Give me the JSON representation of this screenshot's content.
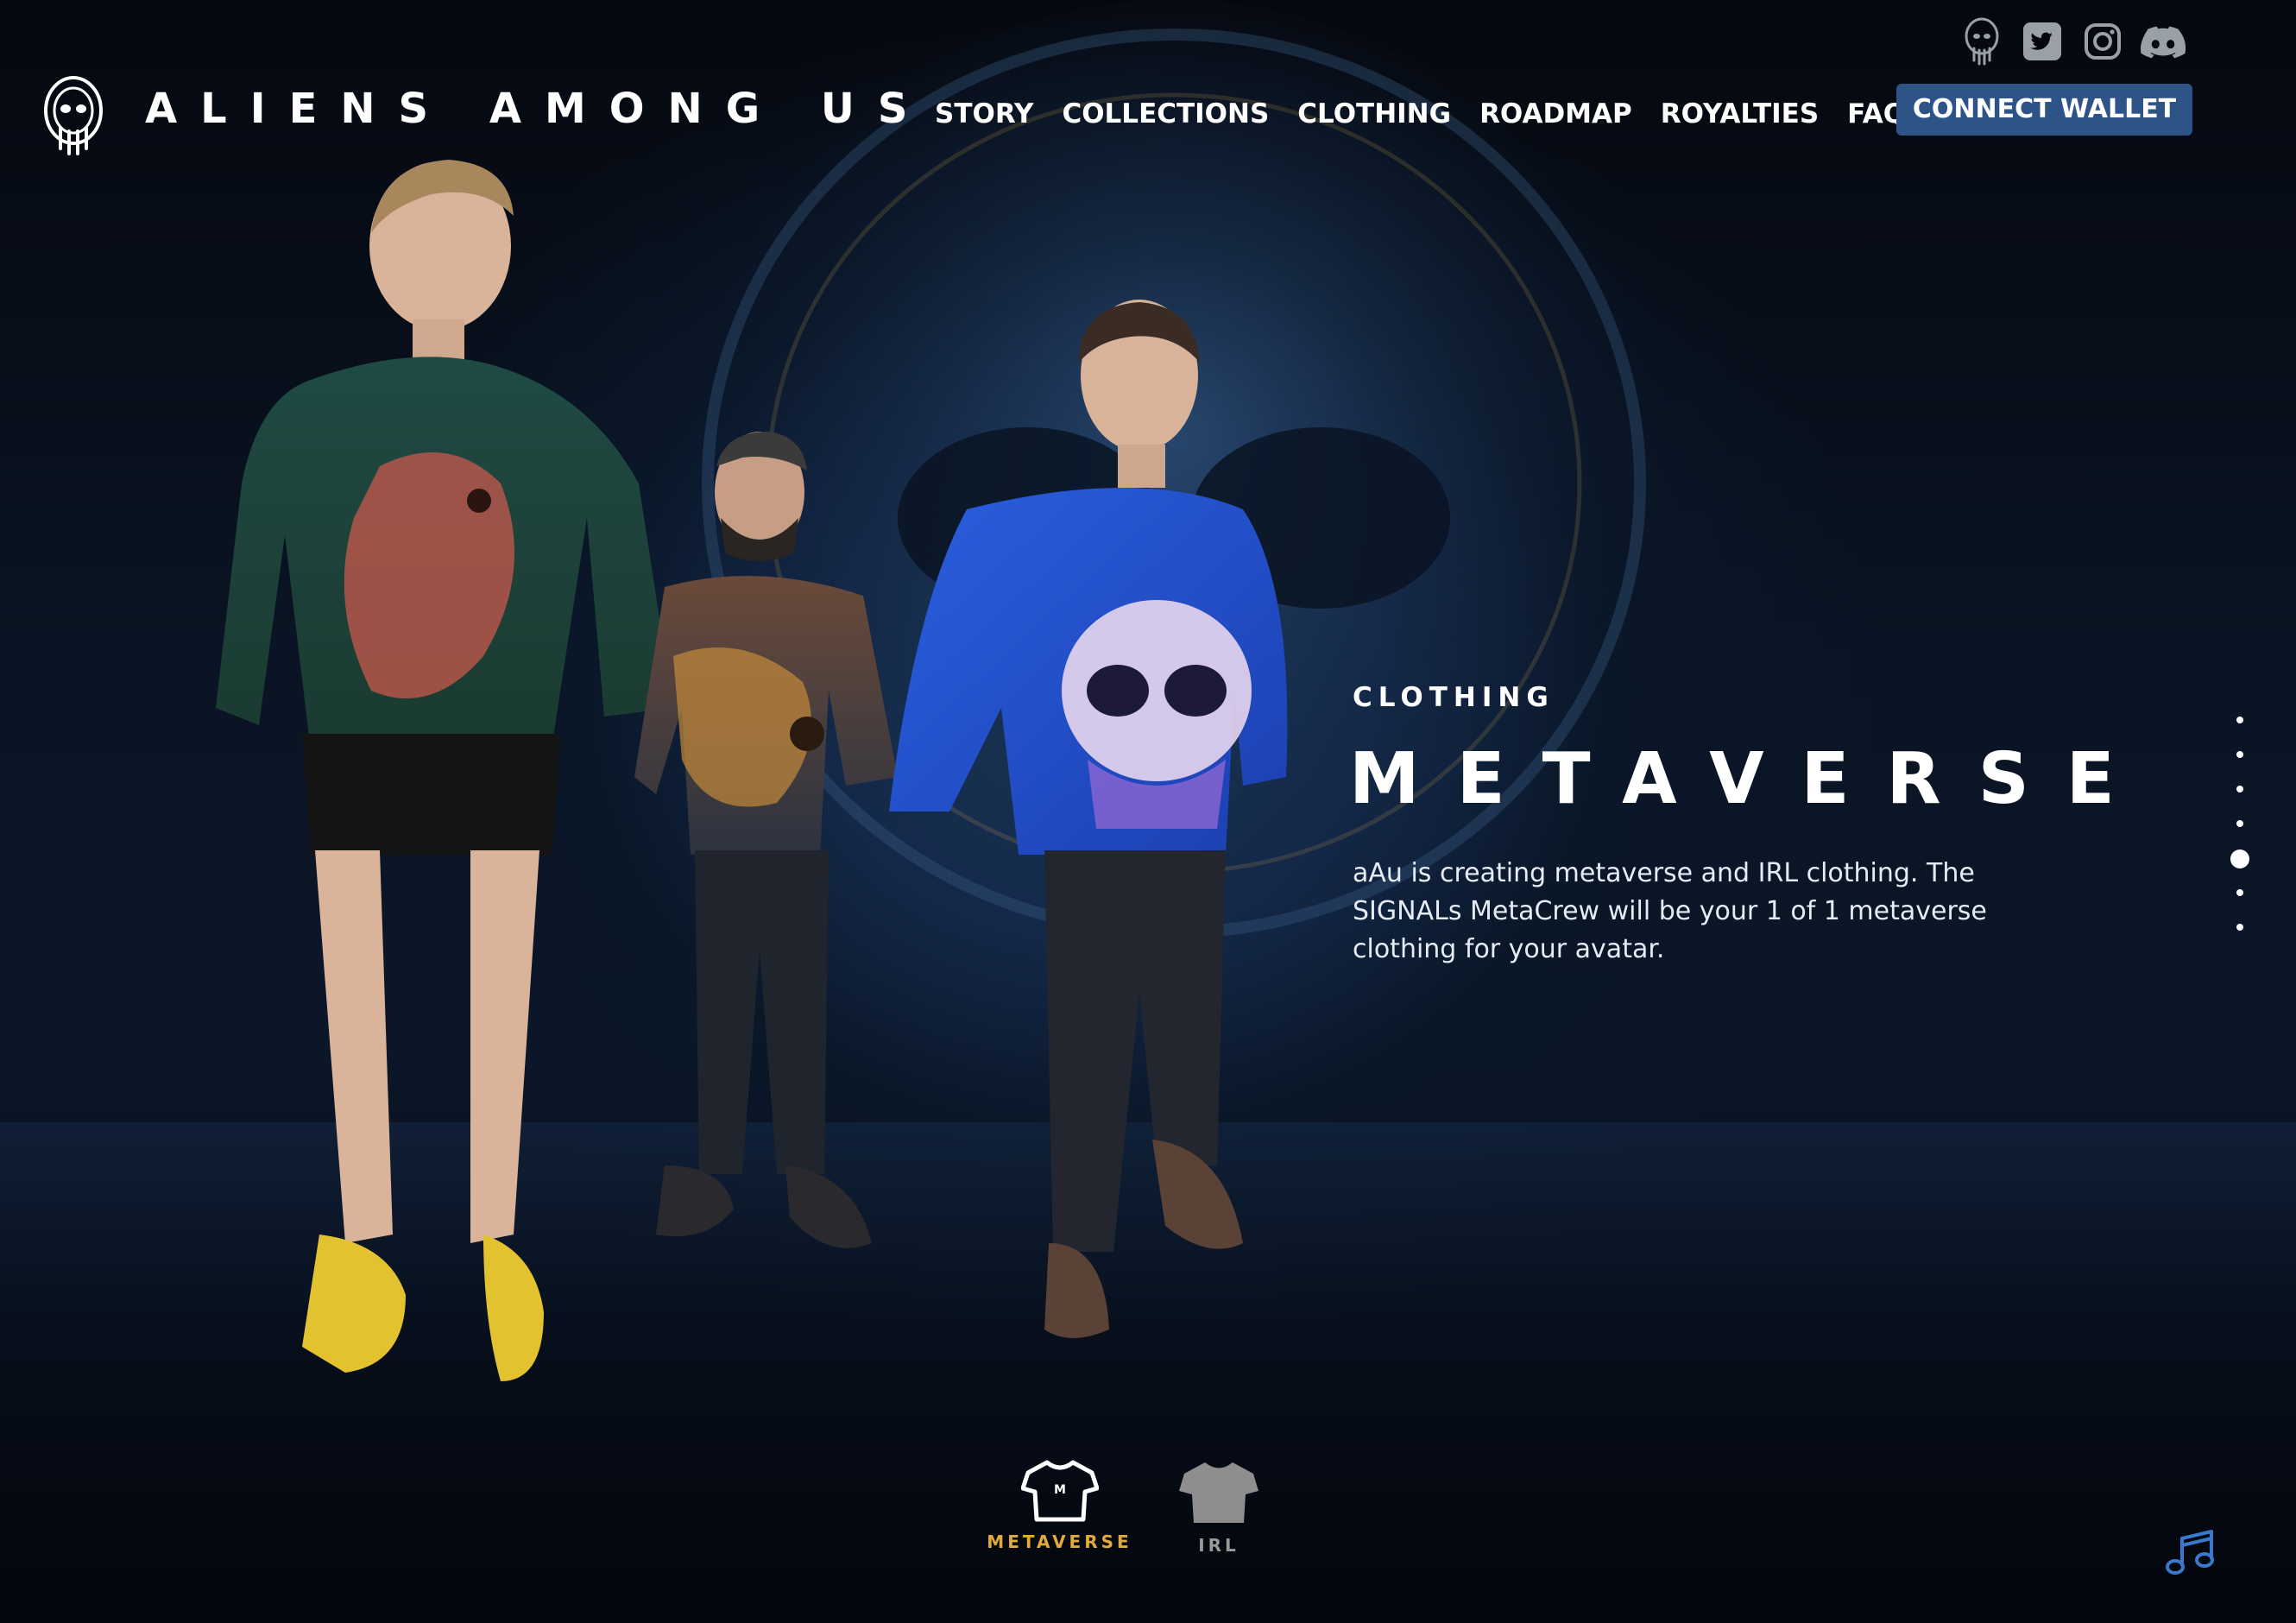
{
  "brand": {
    "name": "ALIENS AMONG US",
    "logo_icon": "alien-head-logo-icon"
  },
  "nav": {
    "items": [
      "STORY",
      "COLLECTIONS",
      "CLOTHING",
      "ROADMAP",
      "ROYALTIES",
      "FAQ"
    ],
    "connect_label": "CONNECT WALLET"
  },
  "socials": [
    "alien-logo-icon",
    "twitter-icon",
    "instagram-icon",
    "discord-icon"
  ],
  "hero": {
    "section_label": "CLOTHING",
    "title": "METAVERSE",
    "description": "aAu is creating metaverse and IRL clothing. The SIGNALs MetaCrew will be your 1 of 1 metaverse clothing for your avatar."
  },
  "pager": {
    "count": 7,
    "active_index": 4
  },
  "toggle": {
    "options": [
      {
        "label": "METAVERSE",
        "icon": "tshirt-outline-icon",
        "active": true
      },
      {
        "label": "IRL",
        "icon": "tshirt-filled-icon",
        "active": false
      }
    ],
    "active_color": "#e2a93b",
    "inactive_color": "#9a9a9a"
  },
  "music_icon": "music-note-icon",
  "colors": {
    "accent": "#2d5387",
    "background": "#03060c"
  }
}
